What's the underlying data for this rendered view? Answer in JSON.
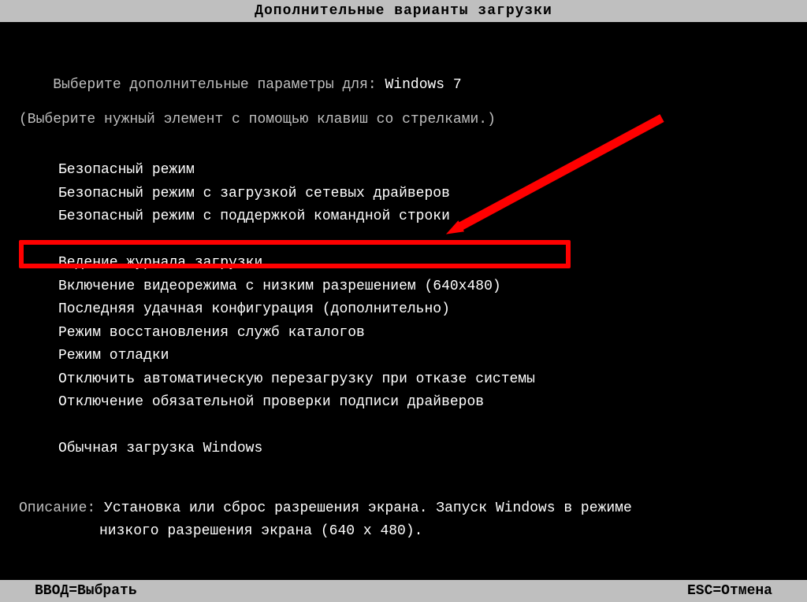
{
  "title": "Дополнительные варианты загрузки",
  "prompt_prefix": "Выберите дополнительные параметры для: ",
  "prompt_os": "Windows 7",
  "instructions": "(Выберите нужный элемент с помощью клавиш со стрелками.)",
  "options_group1": [
    "Безопасный режим",
    "Безопасный режим с загрузкой сетевых драйверов",
    "Безопасный режим с поддержкой командной строки"
  ],
  "options_group2": [
    "Ведение журнала загрузки",
    "Включение видеорежима с низким разрешением (640x480)",
    "Последняя удачная конфигурация (дополнительно)",
    "Режим восстановления служб каталогов",
    "Режим отладки",
    "Отключить автоматическую перезагрузку при отказе системы",
    "Отключение обязательной проверки подписи драйверов"
  ],
  "options_group3": [
    "Обычная загрузка Windows"
  ],
  "selected_index_group2": 1,
  "description_label": "Описание: ",
  "description_text_line1": "Установка или сброс разрешения экрана. Запуск Windows в режиме",
  "description_text_line2": "низкого разрешения экрана (640 x 480).",
  "footer_left": "ВВОД=Выбрать",
  "footer_right": "ESC=Отмена",
  "annotation": {
    "arrow_icon": "red-arrow",
    "highlight_box": true
  }
}
